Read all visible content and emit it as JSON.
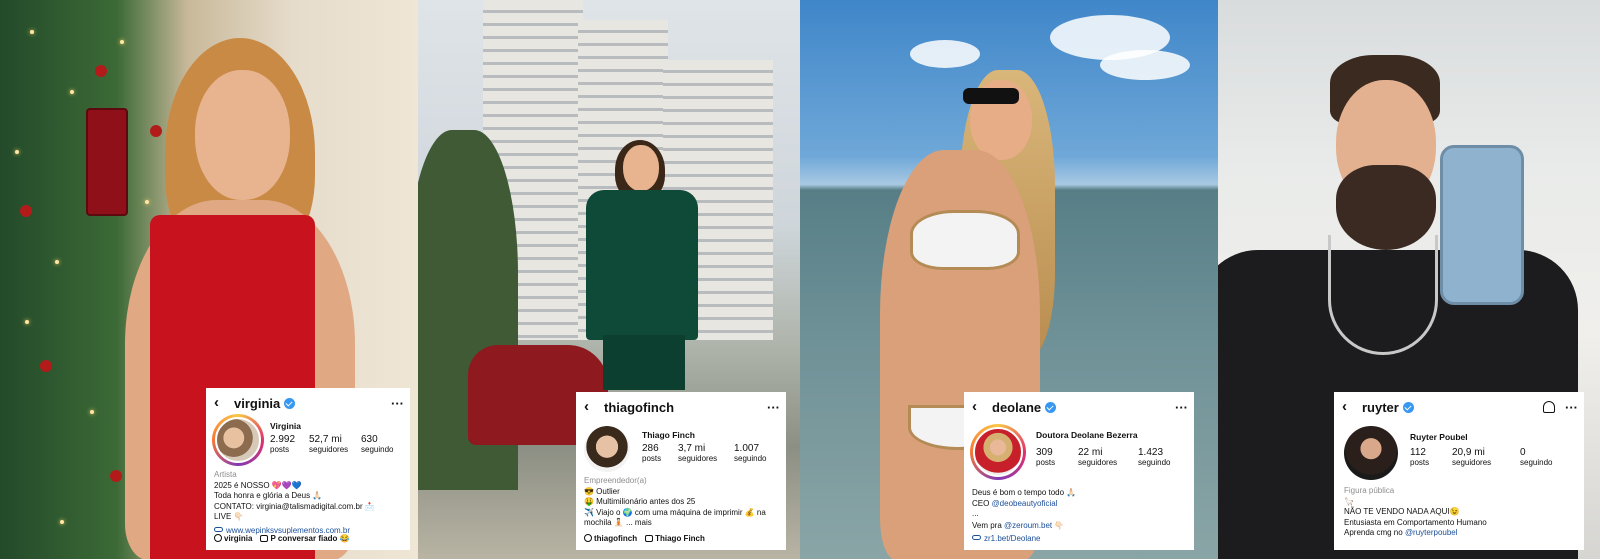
{
  "profiles": [
    {
      "username": "virginia",
      "display_name": "Virginia",
      "posts": "2.992",
      "posts_label": "posts",
      "followers": "52,7 mi",
      "followers_label": "seguidores",
      "following": "630",
      "following_label": "seguindo",
      "category": "Artista",
      "bio": [
        "2025 é NOSSO 💖💜💙",
        "Toda honra e glória a Deus 🙏🏻",
        "CONTATO: virginia@talismadigital.com.br 📩",
        "LIVE 👇🏻"
      ],
      "link": "www.wepinksvsuplementos.com.br",
      "bottom_items": [
        "virginia",
        "P conversar fiado 😂"
      ]
    },
    {
      "username": "thiagofinch",
      "display_name": "Thiago Finch",
      "posts": "286",
      "posts_label": "posts",
      "followers": "3,7 mi",
      "followers_label": "seguidores",
      "following": "1.007",
      "following_label": "seguindo",
      "category": "Empreendedor(a)",
      "bio": [
        "😎 Outlier",
        "🤑 Multimilionário antes dos 25",
        "✈️ Viajo o 🌍 com uma máquina de imprimir 💰 na",
        "mochila 🧘🏻 ... mais"
      ],
      "bottom_items": [
        "thiagofinch",
        "Thiago Finch"
      ]
    },
    {
      "username": "deolane",
      "display_name": "Doutora Deolane Bezerra",
      "posts": "309",
      "posts_label": "posts",
      "followers": "22 mi",
      "followers_label": "seguidores",
      "following": "1.423",
      "following_label": "seguindo",
      "bio_prefix": "Deus é bom o tempo todo 🙏🏻",
      "ceo_prefix": "CEO ",
      "ceo_handle": "@deobeautyoficial",
      "ellipsis": "...",
      "vem_prefix": "Vem pra ",
      "vem_handle": "@zeroum.bet",
      "vem_suffix": " 👇🏻",
      "link": "zr1.bet/Deolane"
    },
    {
      "username": "ruyter",
      "display_name": "Ruyter Poubel",
      "posts": "112",
      "posts_label": "posts",
      "followers": "20,9 mi",
      "followers_label": "seguidores",
      "following": "0",
      "following_label": "seguindo",
      "category": "Figura pública",
      "bio": [
        "🦙",
        "NÃO TE VENDO NADA AQUI😉",
        "Entusiasta em Comportamento Humano"
      ],
      "learn_prefix": "Aprenda cmg no ",
      "learn_handle": "@ruyterpoubel"
    }
  ],
  "ui": {
    "back": "‹",
    "more": "···"
  },
  "colors": {
    "verified": "#3897f0",
    "link": "#1b4f9a",
    "category": "#8e8e8e"
  }
}
